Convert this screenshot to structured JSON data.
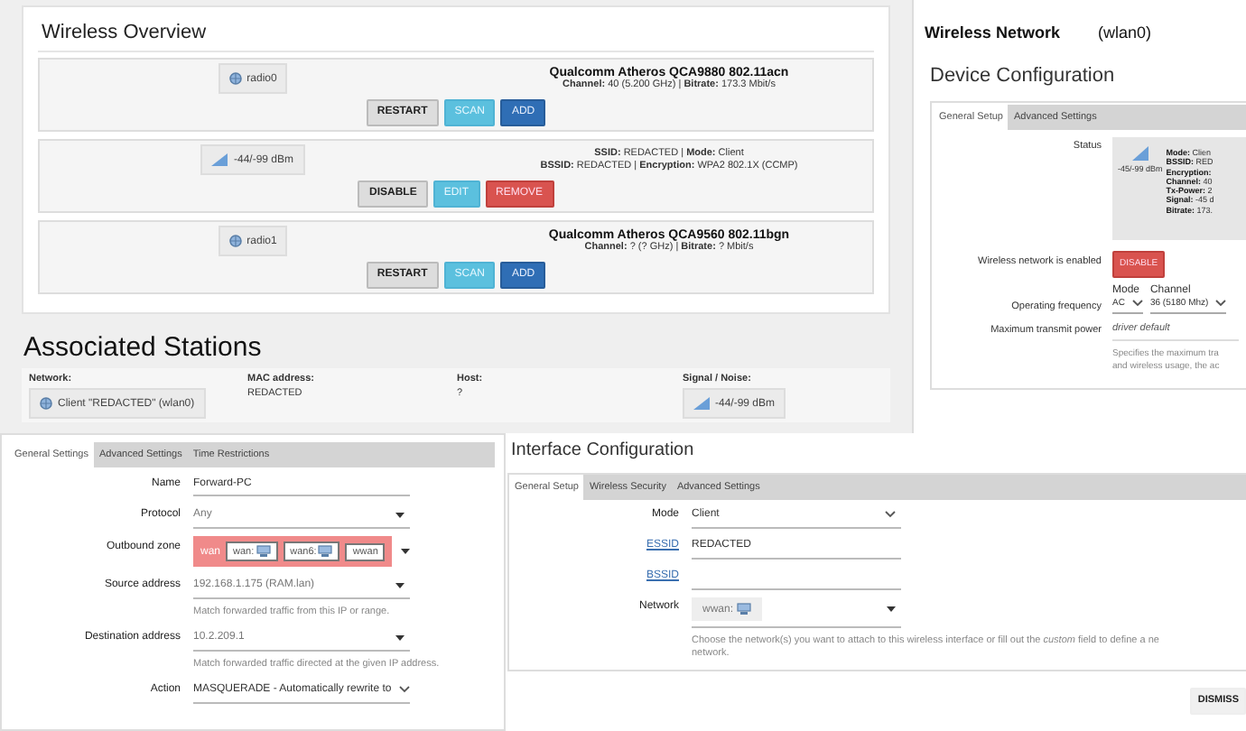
{
  "wireless_overview": {
    "title": "Wireless Overview",
    "rows": [
      {
        "kind": "radio",
        "badge": "radio0",
        "title": "Qualcomm Atheros QCA9880 802.11acn",
        "details": [
          "**Channel:** 40 (5.200 GHz) | **Bitrate:** 173.3 Mbit/s"
        ],
        "buttons": [
          {
            "label": "RESTART",
            "kind": "default"
          },
          {
            "label": "SCAN",
            "kind": "info"
          },
          {
            "label": "ADD",
            "kind": "primary"
          }
        ]
      },
      {
        "kind": "network",
        "badge": "-44/-99 dBm",
        "details": [
          "**SSID:** REDACTED | **Mode:** Client",
          "**BSSID:** REDACTED | **Encryption:** WPA2 802.1X (CCMP)"
        ],
        "buttons": [
          {
            "label": "DISABLE",
            "kind": "default"
          },
          {
            "label": "EDIT",
            "kind": "info"
          },
          {
            "label": "REMOVE",
            "kind": "danger"
          }
        ]
      },
      {
        "kind": "radio",
        "badge": "radio1",
        "title": "Qualcomm Atheros QCA9560 802.11bgn",
        "details": [
          "**Channel:** ? (? GHz) | **Bitrate:** ? Mbit/s"
        ],
        "buttons": [
          {
            "label": "RESTART",
            "kind": "default"
          },
          {
            "label": "SCAN",
            "kind": "info"
          },
          {
            "label": "ADD",
            "kind": "primary"
          }
        ]
      }
    ]
  },
  "associated_stations": {
    "title": "Associated Stations",
    "columns": [
      "Network:",
      "MAC address:",
      "Host:",
      "Signal / Noise:"
    ],
    "rows": [
      {
        "network": "Client \"REDACTED\" (wlan0)",
        "mac": "REDACTED",
        "host": "?",
        "signal": "-44/-99 dBm"
      }
    ]
  },
  "wireless_network": {
    "title": "Wireless Network",
    "device": "(wlan0)",
    "heading": "Device Configuration",
    "tabs": [
      {
        "label": "General Setup",
        "selected": true
      },
      {
        "label": "Advanced Settings",
        "selected": false
      }
    ],
    "fields": [
      {
        "kind": "status",
        "label": "Status",
        "signal": "-45/-99 dBm",
        "lines": [
          "**Mode:** Clien",
          "**BSSID:** RED",
          "**Encryption:**",
          "**Channel:** 40",
          "**Tx-Power:** 2",
          "**Signal:** -45 d",
          "**Bitrate:** 173."
        ]
      },
      {
        "kind": "button",
        "label": "Wireless network is enabled",
        "button": "DISABLE"
      },
      {
        "kind": "frequency",
        "label": "Operating frequency",
        "columns": [
          {
            "heading": "Mode",
            "value": "AC"
          },
          {
            "heading": "Channel",
            "value": "36 (5180 Mhz)"
          }
        ]
      },
      {
        "kind": "text",
        "label": "Maximum transmit power",
        "placeholder": "driver default",
        "hint_lines": [
          "Specifies the maximum tra",
          "and wireless usage, the ac"
        ]
      }
    ]
  },
  "traffic_rule": {
    "tabs": [
      {
        "label": "General Settings",
        "selected": true
      },
      {
        "label": "Advanced Settings",
        "selected": false
      },
      {
        "label": "Time Restrictions",
        "selected": false
      }
    ],
    "fields": [
      {
        "kind": "input",
        "label": "Name",
        "value": "Forward-PC"
      },
      {
        "kind": "select",
        "label": "Protocol",
        "value": "Any"
      },
      {
        "kind": "zones",
        "label": "Outbound zone",
        "zone": "wan",
        "chips": [
          {
            "label": "wan:",
            "icon": true
          },
          {
            "label": "wan6:",
            "icon": true
          },
          {
            "label": "wwan",
            "icon": false
          }
        ]
      },
      {
        "kind": "select",
        "label": "Source address",
        "value": "192.168.1.175 (RAM.lan)",
        "hint": "Match forwarded traffic from this IP or range."
      },
      {
        "kind": "select",
        "label": "Destination address",
        "value": "10.2.209.1",
        "hint": "Match forwarded traffic directed at the given IP address."
      },
      {
        "kind": "dropdown",
        "label": "Action",
        "value": "MASQUERADE - Automatically rewrite to"
      }
    ]
  },
  "interface_configuration": {
    "title": "Interface Configuration",
    "tabs": [
      {
        "label": "General Setup",
        "selected": true
      },
      {
        "label": "Wireless Security",
        "selected": false
      },
      {
        "label": "Advanced Settings",
        "selected": false
      }
    ],
    "fields": [
      {
        "kind": "dropdown",
        "label": "Mode",
        "value": "Client"
      },
      {
        "kind": "input",
        "label": "ESSID",
        "link": true,
        "value": "REDACTED"
      },
      {
        "kind": "input",
        "label": "BSSID",
        "link": true
      },
      {
        "kind": "network",
        "label": "Network",
        "chips": [
          {
            "label": "wwan:",
            "icon": true
          }
        ],
        "hint_lines": [
          "Choose the network(s) you want to attach to this wireless interface or fill out the *custom* field to define a ne",
          "network."
        ]
      }
    ],
    "button": "DISMISS"
  }
}
